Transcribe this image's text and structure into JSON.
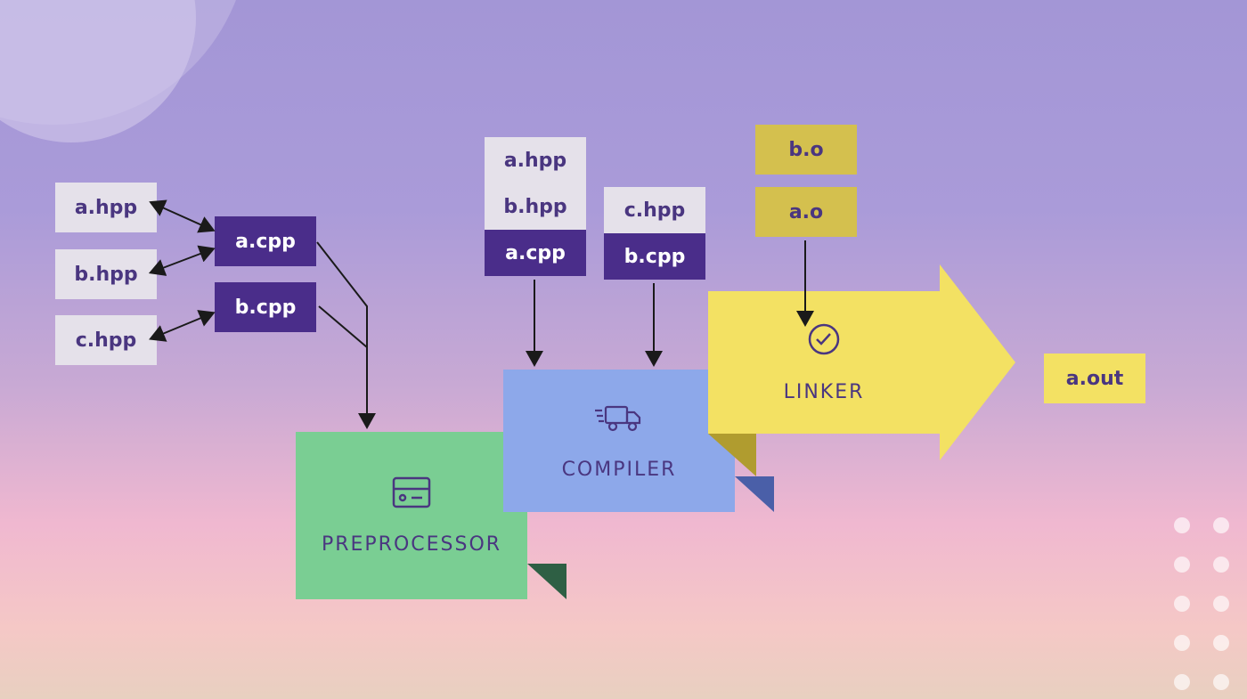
{
  "source_headers": {
    "files": [
      "a.hpp",
      "b.hpp",
      "c.hpp"
    ]
  },
  "source_impl": {
    "files": [
      "a.cpp",
      "b.cpp"
    ]
  },
  "translation_units": [
    {
      "headers": [
        "a.hpp",
        "b.hpp"
      ],
      "impl": "a.cpp"
    },
    {
      "headers": [
        "c.hpp"
      ],
      "impl": "b.cpp"
    }
  ],
  "object_files": [
    "b.o",
    "a.o"
  ],
  "output": {
    "file": "a.out"
  },
  "stages": {
    "preprocessor": {
      "label": "PREPROCESSOR"
    },
    "compiler": {
      "label": "COMPILER"
    },
    "linker": {
      "label": "LINKER"
    }
  },
  "colors": {
    "purple": "#4a2d8a",
    "light_grey": "#e5e1ea",
    "green": "#7ace93",
    "blue": "#8da8ea",
    "yellow": "#f3e163",
    "mustard": "#d4c04e",
    "text": "#4a3680"
  }
}
